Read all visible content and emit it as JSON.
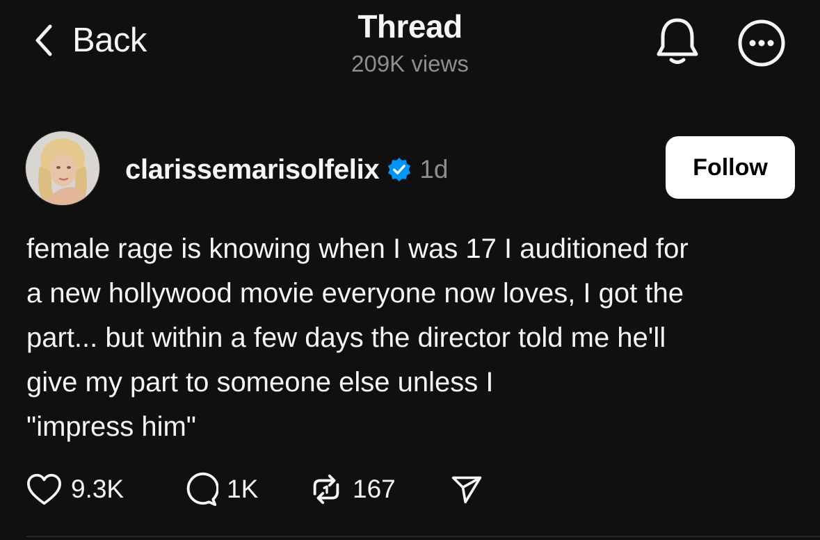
{
  "header": {
    "back_label": "Back",
    "title": "Thread",
    "views": "209K views"
  },
  "post": {
    "username": "clarissemarisolfelix",
    "verified": true,
    "time": "1d",
    "follow_label": "Follow",
    "text_lines": [
      "female rage is knowing when I was 17 I auditioned for",
      "a new hollywood movie everyone now loves, I got the",
      "part... but within a few days the director told me he'll",
      "give my part to someone else unless I",
      "\"impress him\""
    ],
    "actions": {
      "likes": "9.3K",
      "replies": "1K",
      "reposts": "167"
    }
  },
  "icons": {
    "back": "chevron-left-icon",
    "bell": "bell-icon",
    "more": "more-icon",
    "verified": "verified-badge-icon",
    "like": "heart-icon",
    "reply": "comment-icon",
    "repost": "repost-icon",
    "share": "send-icon"
  },
  "colors": {
    "background": "#101010",
    "text": "#f3f5f7",
    "muted": "#8e8e8e",
    "verified": "#0095f6",
    "follow_bg": "#ffffff"
  }
}
